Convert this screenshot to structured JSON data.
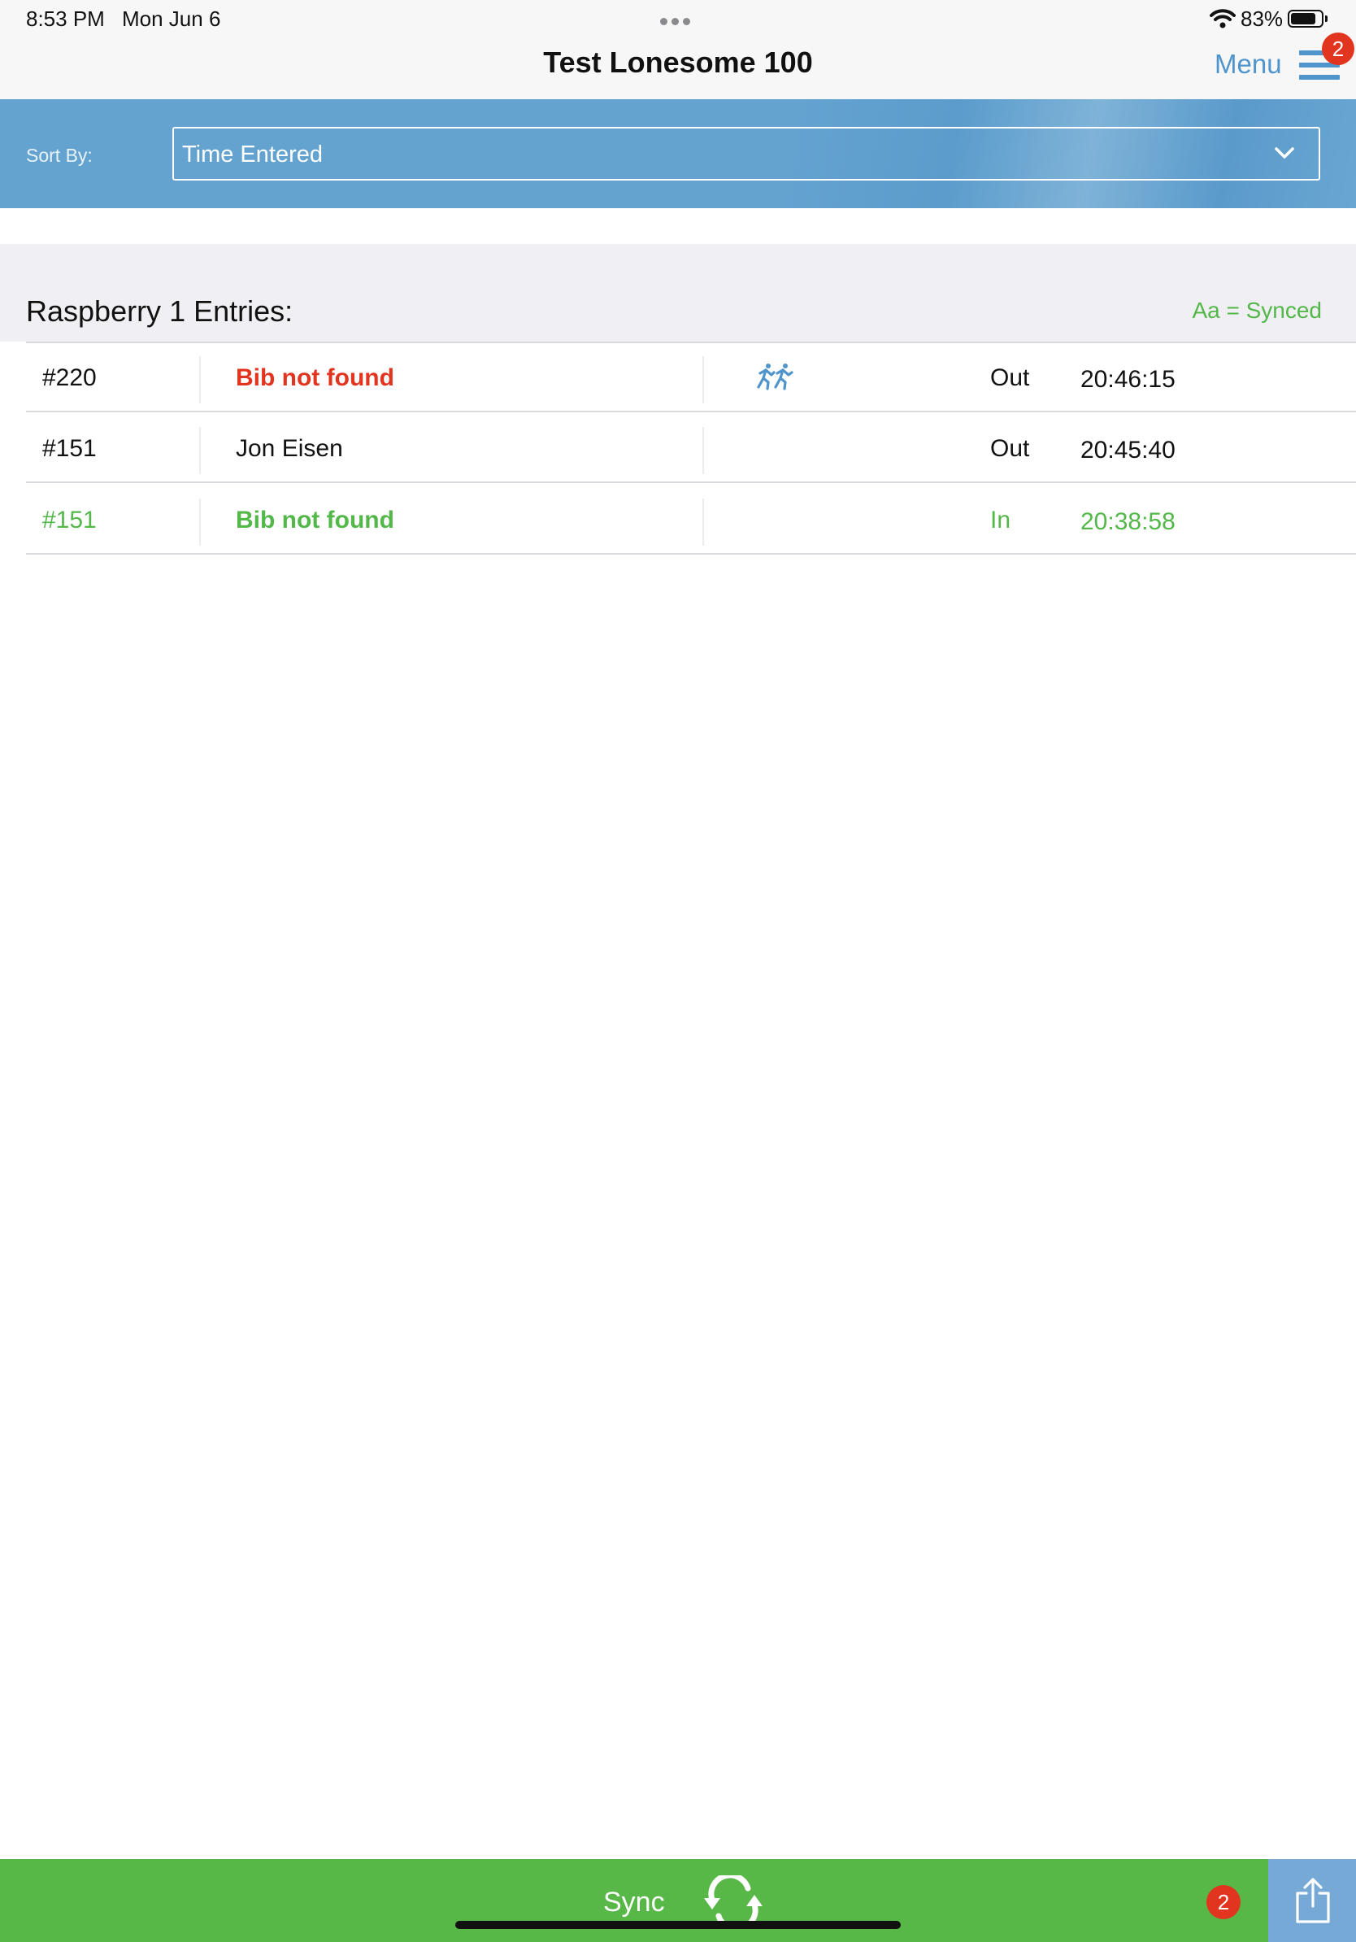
{
  "status_bar": {
    "time": "8:53 PM",
    "date": "Mon Jun 6",
    "battery_percent": "83%",
    "battery_level": 0.83
  },
  "nav": {
    "title": "Test Lonesome 100",
    "menu_label": "Menu",
    "menu_badge": "2"
  },
  "sort": {
    "label": "Sort By:",
    "selected": "Time Entered"
  },
  "section": {
    "title": "Raspberry 1 Entries:",
    "legend": "Aa = Synced"
  },
  "entries": [
    {
      "bib": "#220",
      "name": "Bib not found",
      "icon": "runners-icon",
      "direction": "Out",
      "time": "20:46:15",
      "status": "not-found"
    },
    {
      "bib": "#151",
      "name": "Jon Eisen",
      "icon": "",
      "direction": "Out",
      "time": "20:45:40",
      "status": "normal"
    },
    {
      "bib": "#151",
      "name": "Bib not found",
      "icon": "",
      "direction": "In",
      "time": "20:38:58",
      "status": "synced"
    }
  ],
  "bottom": {
    "sync_label": "Sync",
    "sync_icon": "sync-arrows-icon",
    "pending_badge": "2",
    "share_icon": "share-icon"
  },
  "colors": {
    "accent_blue": "#4f95cc",
    "header_blue": "#64a3d0",
    "sync_green": "#57b848",
    "synced_text_green": "#53b849",
    "error_red": "#e1351f",
    "share_blue": "#76a9d6"
  }
}
